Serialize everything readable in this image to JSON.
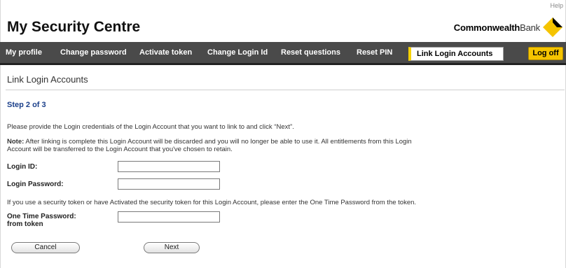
{
  "header": {
    "help_label": "Help",
    "title": "My Security Centre",
    "brand_bold": "Commonwealth",
    "brand_rest": "Bank"
  },
  "nav": {
    "items": [
      {
        "label": "My profile"
      },
      {
        "label": "Change password"
      },
      {
        "label": "Activate token"
      },
      {
        "label": "Change Login Id"
      },
      {
        "label": "Reset questions"
      },
      {
        "label": "Reset PIN"
      }
    ],
    "active_label": "Link Login Accounts",
    "logoff_label": "Log off"
  },
  "main": {
    "heading": "Link Login Accounts",
    "step": "Step 2 of 3",
    "intro": "Please provide the Login credentials of the Login Account that you want to link to and click “Next”.",
    "note_label": "Note:",
    "note_line1": " After linking is complete this Login Account will be discarded and you will no longer be able to use it. All entitlements from this Login",
    "note_line2": "Account will be transferred to the Login Account that you've chosen to retain.",
    "token_info": "If you use a security token or have Activated the security token for this Login Account, please enter the One Time Password from the token."
  },
  "form": {
    "login_id_label": "Login ID:",
    "login_id_value": "",
    "password_label": "Login Password:",
    "password_value": "",
    "otp_label_line1": "One Time Password:",
    "otp_label_line2": "from token",
    "otp_value": ""
  },
  "actions": {
    "cancel_label": "Cancel",
    "next_label": "Next"
  },
  "colors": {
    "nav_bg": "#4a4a4a",
    "brand_yellow": "#f5c400",
    "step_blue": "#1a3f8a"
  }
}
